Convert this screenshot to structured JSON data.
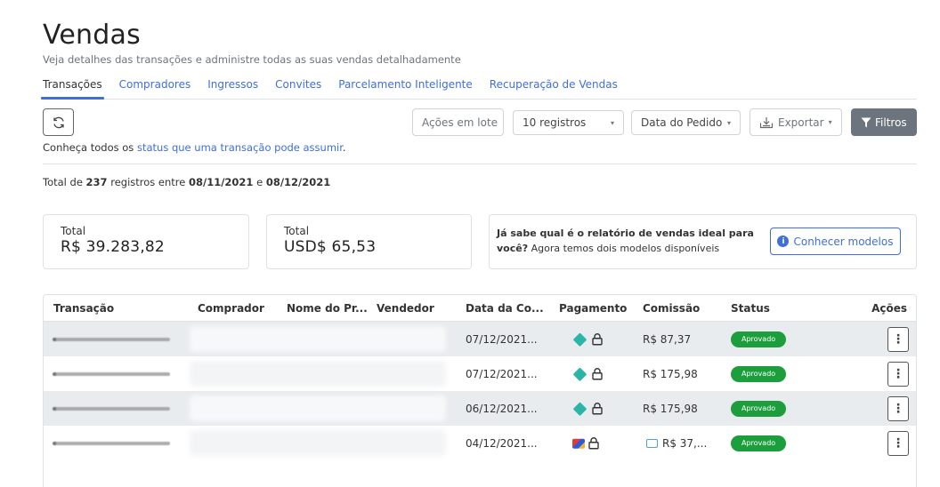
{
  "header": {
    "title": "Vendas",
    "subtitle": "Veja detalhes das transações e administre todas as suas vendas detalhadamente"
  },
  "tabs": [
    {
      "label": "Transações",
      "active": true
    },
    {
      "label": "Compradores",
      "active": false
    },
    {
      "label": "Ingressos",
      "active": false
    },
    {
      "label": "Convites",
      "active": false
    },
    {
      "label": "Parcelamento Inteligente",
      "active": false
    },
    {
      "label": "Recuperação de Vendas",
      "active": false
    }
  ],
  "toolbar": {
    "refresh_icon": "refresh-icon",
    "batch_actions": "Ações em lote",
    "records_select": "10 registros",
    "date_select": "Data do Pedido",
    "export": "Exportar",
    "filters": "Filtros"
  },
  "status_line": {
    "prefix": "Conheça todos os ",
    "link": "status que uma transação pode assumir",
    "suffix": "."
  },
  "total_line": {
    "prefix": "Total de ",
    "count": "237",
    "middle": " registros entre ",
    "start": "08/11/2021",
    "and": " e ",
    "end": "08/12/2021"
  },
  "cards": {
    "total_brl": {
      "label": "Total",
      "value": "R$ 39.283,82"
    },
    "total_usd": {
      "label": "Total",
      "value": "USD$ 65,53"
    },
    "info": {
      "bold1": "Já sabe qual é o relatório de vendas ideal para você?",
      "text": " Agora temos dois modelos disponíveis",
      "button": "Conhecer modelos"
    }
  },
  "table": {
    "headers": {
      "transacao": "Transação",
      "comprador": "Comprador",
      "nome": "Nome do Pr...",
      "vendedor": "Vendedor",
      "data": "Data da Co...",
      "pagamento": "Pagamento",
      "comissao": "Comissão",
      "status": "Status",
      "acoes": "Ações"
    },
    "rows": [
      {
        "date": "07/12/2021...",
        "payment": "pix",
        "commission": "R$ 87,37",
        "status": "Aprovado"
      },
      {
        "date": "07/12/2021...",
        "payment": "pix",
        "commission": "R$ 175,98",
        "status": "Aprovado"
      },
      {
        "date": "06/12/2021...",
        "payment": "pix",
        "commission": "R$ 175,98",
        "status": "Aprovado"
      },
      {
        "date": "04/12/2021...",
        "payment": "card",
        "commission": "R$ 37,...",
        "status": "Aprovado"
      }
    ]
  },
  "colors": {
    "accent": "#3f6fd8",
    "approved": "#1d9e3d",
    "pix": "#2bb5a8",
    "filter_button": "#6c757d"
  }
}
